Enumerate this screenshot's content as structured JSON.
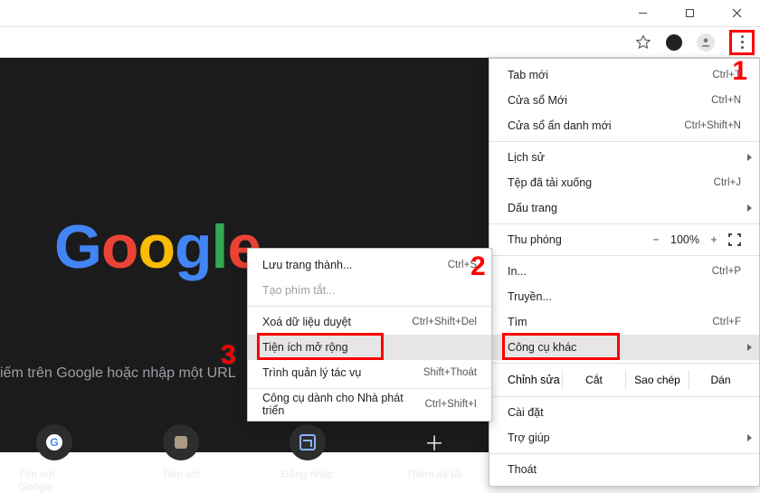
{
  "window": {
    "min_name": "minimize",
    "max_name": "maximize",
    "close_name": "close"
  },
  "toolbar": {
    "star_name": "bookmark-star",
    "profile_name": "profile",
    "kebab_name": "more"
  },
  "logo": {
    "g1": "G",
    "o1": "o",
    "o2": "o",
    "g2": "g",
    "l": "l",
    "e": "e",
    "c_g1": "#4285F4",
    "c_o1": "#EA4335",
    "c_o2": "#FBBC05",
    "c_g2": "#4285F4",
    "c_l": "#34A853",
    "c_e": "#EA4335"
  },
  "tagline": "iếm trên Google hoặc nhập một URL",
  "shortcuts": [
    {
      "label": "Tìm với Google",
      "type": "google"
    },
    {
      "label": "Tiện ích",
      "type": "puzzle"
    },
    {
      "label": "Đăng nhập",
      "type": "login"
    },
    {
      "label": "Thêm lối tắt",
      "type": "add"
    }
  ],
  "menu": {
    "new_tab": {
      "label": "Tab mới",
      "shortcut": "Ctrl+T"
    },
    "new_window": {
      "label": "Cửa sổ Mới",
      "shortcut": "Ctrl+N"
    },
    "new_incognito": {
      "label": "Cửa sổ ẩn danh mới",
      "shortcut": "Ctrl+Shift+N"
    },
    "history": {
      "label": "Lịch sử"
    },
    "downloads": {
      "label": "Tệp đã tải xuống",
      "shortcut": "Ctrl+J"
    },
    "bookmarks": {
      "label": "Dấu trang"
    },
    "zoom": {
      "label": "Thu phóng",
      "value": "100%",
      "minus": "−",
      "plus": "+"
    },
    "print": {
      "label": "In...",
      "shortcut": "Ctrl+P"
    },
    "cast": {
      "label": "Truyền..."
    },
    "find": {
      "label": "Tìm",
      "shortcut": "Ctrl+F"
    },
    "more_tools": {
      "label": "Công cụ khác"
    },
    "edit": {
      "label": "Chỉnh sửa",
      "cut": "Cắt",
      "copy": "Sao chép",
      "paste": "Dán"
    },
    "settings": {
      "label": "Cài đặt"
    },
    "help": {
      "label": "Trợ giúp"
    },
    "exit": {
      "label": "Thoát"
    }
  },
  "submenu": {
    "save_page": {
      "label": "Lưu trang thành...",
      "shortcut": "Ctrl+S"
    },
    "create_shortcut": {
      "label": "Tạo phím tắt..."
    },
    "clear_data": {
      "label": "Xoá dữ liệu duyệt",
      "shortcut": "Ctrl+Shift+Del"
    },
    "extensions": {
      "label": "Tiện ích mở rộng"
    },
    "task_manager": {
      "label": "Trình quản lý tác vụ",
      "shortcut": "Shift+Thoát"
    },
    "dev_tools": {
      "label": "Công cụ dành cho Nhà phát triển",
      "shortcut": "Ctrl+Shift+I"
    }
  },
  "annotations": {
    "one": "1",
    "two": "2",
    "three": "3"
  }
}
